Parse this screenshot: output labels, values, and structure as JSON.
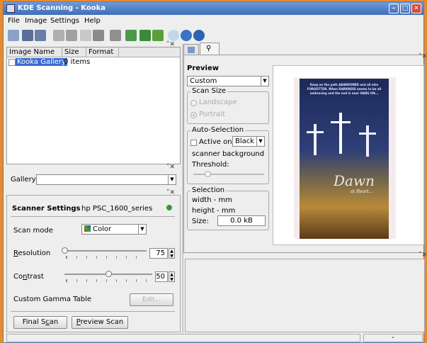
{
  "window": {
    "title": "KDE Scanning - Kooka",
    "btn_min": "–",
    "btn_max": "□",
    "btn_close": "✕"
  },
  "menubar": {
    "file": "File",
    "image": "Image",
    "settings": "Settings",
    "help": "Help"
  },
  "gallery": {
    "columns": [
      "Image Name",
      "Size",
      "Format"
    ],
    "row_name": "Kooka Gallery",
    "row_size": "0 items",
    "combo_label": "Gallery:"
  },
  "scanner": {
    "title": "Scanner Settings",
    "device": "hp PSC_1600_series",
    "status_color": "#2fa02f",
    "scan_mode_label": "Scan mode",
    "scan_mode_value": "Color",
    "resolution_label": "Resolution",
    "resolution_value": "75",
    "contrast_label": "Contrast",
    "contrast_value": "50",
    "gamma_label": "Custom Gamma Table",
    "gamma_button": "Edit...",
    "final_scan": "Final Scan",
    "preview_scan": "Preview Scan"
  },
  "preview": {
    "title": "Preview",
    "size_combo": "Custom",
    "scan_size_group": "Scan Size",
    "landscape": "Landscape",
    "portrait": "Portrait",
    "autosel_group": "Auto-Selection",
    "active_on": "Active on",
    "bg_value": "Black",
    "scanner_background": "scanner background",
    "threshold": "Threshold:",
    "selection_group": "Selection",
    "width": "width - mm",
    "height": "height - mm",
    "size_label": "Size:",
    "size_value": "0.0 kB"
  },
  "poster": {
    "top_text": "Keep on the path ABANDONED and all else FORGOTTEN. When DARKNESS seems to be all embracing and the end is near HANG ON...",
    "dawn": "Dawn",
    "sub": "at Heart..."
  },
  "statusbar": {
    "right": "-"
  }
}
